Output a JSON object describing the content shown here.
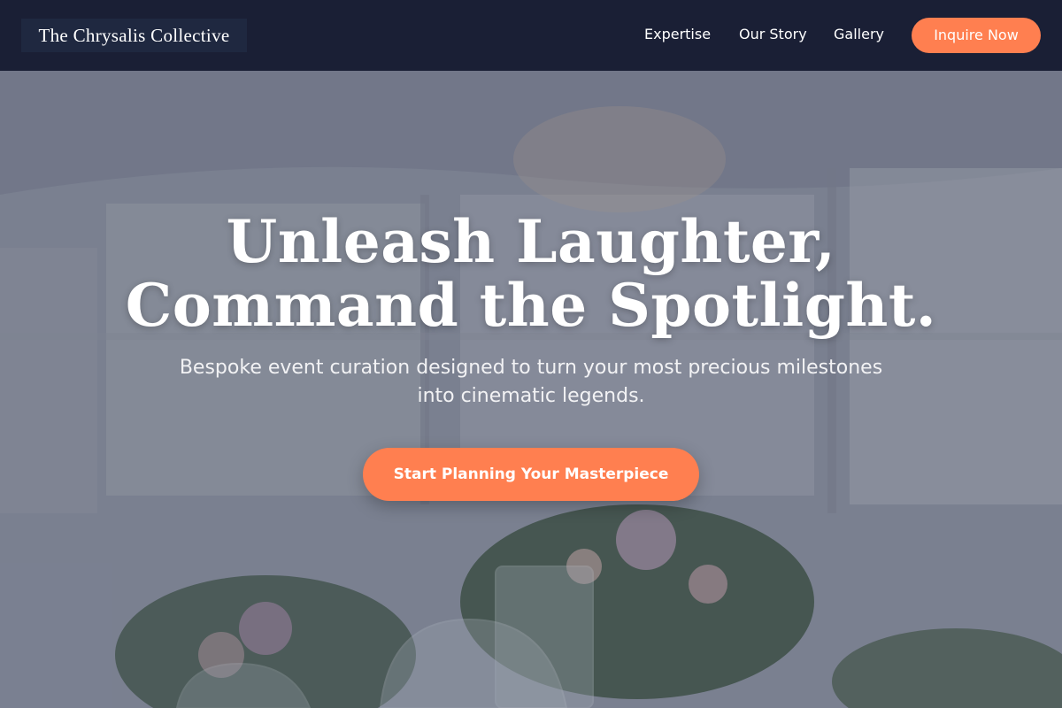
{
  "header": {
    "logo": "The Chrysalis Collective",
    "nav": {
      "expertise": "Expertise",
      "story": "Our Story",
      "gallery": "Gallery"
    },
    "cta": "Inquire Now"
  },
  "hero": {
    "title_line1": "Unleash Laughter,",
    "title_line2": "Command the Spotlight.",
    "subtitle_line1": "Bespoke event curation designed to turn your most precious milestones",
    "subtitle_line2": "into cinematic legends.",
    "cta": "Start Planning Your Masterpiece"
  },
  "colors": {
    "header_bg": "#1a1f35",
    "accent": "#ff7f50",
    "text_light": "#ffffff"
  }
}
